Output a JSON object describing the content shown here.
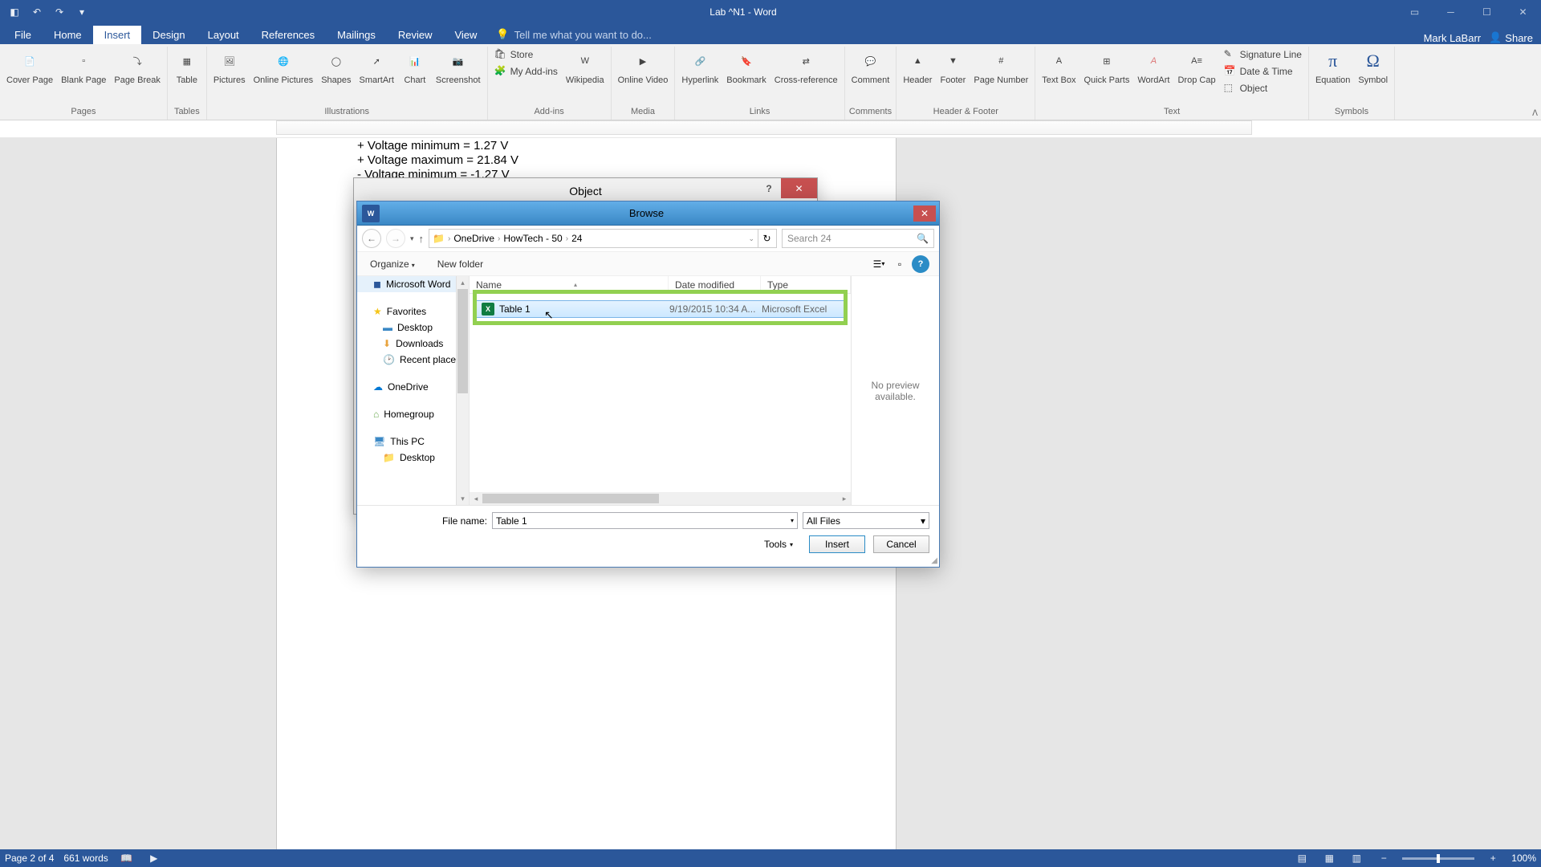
{
  "window": {
    "title": "Lab ^N1 - Word",
    "user": "Mark LaBarr",
    "share": "Share"
  },
  "tabs": [
    "File",
    "Home",
    "Insert",
    "Design",
    "Layout",
    "References",
    "Mailings",
    "Review",
    "View"
  ],
  "active_tab": "Insert",
  "tell_me": "Tell me what you want to do...",
  "ribbon": {
    "groups": {
      "pages": {
        "label": "Pages",
        "items": [
          "Cover Page",
          "Blank Page",
          "Page Break"
        ]
      },
      "tables": {
        "label": "Tables",
        "items": [
          "Table"
        ]
      },
      "illustrations": {
        "label": "Illustrations",
        "items": [
          "Pictures",
          "Online Pictures",
          "Shapes",
          "SmartArt",
          "Chart",
          "Screenshot"
        ]
      },
      "addins": {
        "label": "Add-ins",
        "items": [
          "Store",
          "My Add-ins",
          "Wikipedia"
        ]
      },
      "media": {
        "label": "Media",
        "items": [
          "Online Video"
        ]
      },
      "links": {
        "label": "Links",
        "items": [
          "Hyperlink",
          "Bookmark",
          "Cross-reference"
        ]
      },
      "comments": {
        "label": "Comments",
        "items": [
          "Comment"
        ]
      },
      "headerfooter": {
        "label": "Header & Footer",
        "items": [
          "Header",
          "Footer",
          "Page Number"
        ]
      },
      "text": {
        "label": "Text",
        "items": [
          "Text Box",
          "Quick Parts",
          "WordArt",
          "Drop Cap",
          "Signature Line",
          "Date & Time",
          "Object"
        ]
      },
      "symbols": {
        "label": "Symbols",
        "items": [
          "Equation",
          "Symbol"
        ]
      }
    }
  },
  "document": {
    "lines": [
      "+ Voltage minimum = 1.27 V",
      "+ Voltage maximum = 21.84 V",
      "- Voltage minimum = -1.27 V"
    ]
  },
  "dlg_object": {
    "title": "Object"
  },
  "browse": {
    "title": "Browse",
    "breadcrumb": [
      "OneDrive",
      "HowTech - 50",
      "24"
    ],
    "search_placeholder": "Search 24",
    "toolbar": {
      "organize": "Organize",
      "new_folder": "New folder"
    },
    "nav": {
      "word": "Microsoft Word",
      "favorites": "Favorites",
      "desktop": "Desktop",
      "downloads": "Downloads",
      "recent": "Recent places",
      "onedrive": "OneDrive",
      "homegroup": "Homegroup",
      "thispc": "This PC",
      "desktop2": "Desktop"
    },
    "columns": {
      "name": "Name",
      "date": "Date modified",
      "type": "Type"
    },
    "file": {
      "name": "Table 1",
      "date": "9/19/2015 10:34 A...",
      "type": "Microsoft Excel"
    },
    "preview": "No preview available.",
    "filename_label": "File name:",
    "filename_value": "Table 1",
    "filter": "All Files",
    "tools": "Tools",
    "insert": "Insert",
    "cancel": "Cancel"
  },
  "status": {
    "page": "Page 2 of 4",
    "words": "661 words",
    "zoom": "100%"
  }
}
